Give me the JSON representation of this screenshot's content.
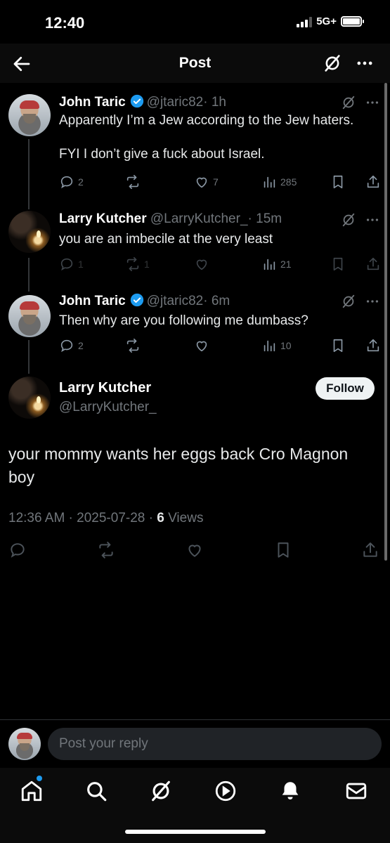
{
  "status": {
    "time": "12:40",
    "network": "5G+"
  },
  "header": {
    "title": "Post"
  },
  "thread": [
    {
      "name": "John Taric",
      "verified": true,
      "handle": "@jtaric82",
      "time": "· 1h",
      "text_lines": [
        "Apparently I’m a Jew according to the Jew haters.",
        "",
        "FYI I don’t give a fuck about Israel."
      ],
      "replies": "2",
      "reposts": "",
      "likes": "7",
      "views": "285"
    },
    {
      "name": "Larry Kutcher",
      "verified": false,
      "handle": "@LarryKutcher_",
      "time": "· 15m",
      "text_lines": [
        "you are an imbecile at the very least"
      ],
      "replies": "1",
      "reposts": "1",
      "likes": "",
      "views": "21"
    },
    {
      "name": "John Taric",
      "verified": true,
      "handle": "@jtaric82",
      "time": "· 6m",
      "text_lines": [
        "Then why are you following me dumbass?"
      ],
      "replies": "2",
      "reposts": "",
      "likes": "",
      "views": "10"
    }
  ],
  "main_post": {
    "name": "Larry Kutcher",
    "handle": "@LarryKutcher_",
    "follow_label": "Follow",
    "text": "your mommy  wants her eggs back Cro Magnon boy",
    "timestamp": "12:36 AM · 2025-07-28 · ",
    "views_count": "6",
    "views_label": " Views"
  },
  "reply": {
    "placeholder": "Post your reply"
  },
  "tabs": [
    "home-icon",
    "search-icon",
    "grok-icon",
    "video-icon",
    "bell-icon",
    "mail-icon"
  ],
  "colors": {
    "accent": "#1d9bf0",
    "background": "#000000",
    "muted": "#71767b"
  }
}
